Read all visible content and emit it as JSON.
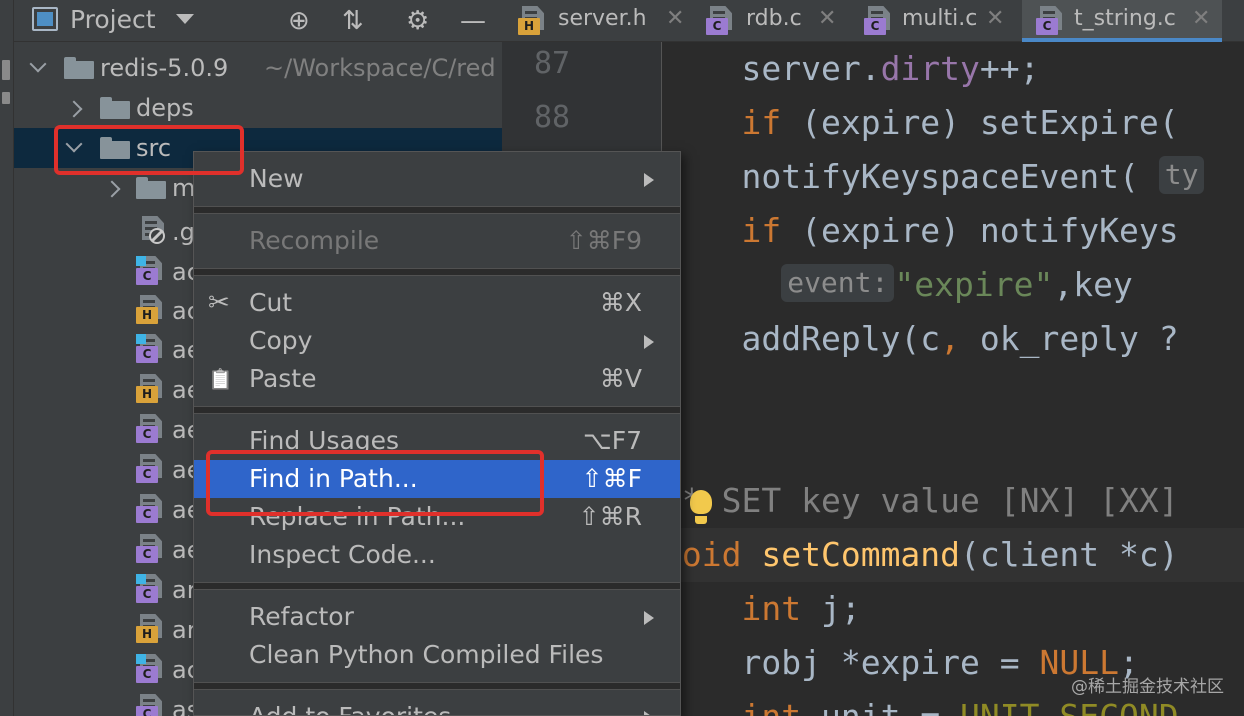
{
  "project_panel": {
    "title": "Project",
    "root": {
      "name": "redis-5.0.9",
      "path": "~/Workspace/C/red"
    },
    "folders": [
      {
        "name": "deps"
      },
      {
        "name": "src"
      },
      {
        "name": "m"
      }
    ],
    "files": [
      {
        "name": ".g",
        "kind": "ignored"
      },
      {
        "name": "ac",
        "kind": "c"
      },
      {
        "name": "ac",
        "kind": "h"
      },
      {
        "name": "ae",
        "kind": "c"
      },
      {
        "name": "ae",
        "kind": "h"
      },
      {
        "name": "ae",
        "kind": "c"
      },
      {
        "name": "ae",
        "kind": "c"
      },
      {
        "name": "ae",
        "kind": "c"
      },
      {
        "name": "ae",
        "kind": "c"
      },
      {
        "name": "ar",
        "kind": "c"
      },
      {
        "name": "ar",
        "kind": "h"
      },
      {
        "name": "ac",
        "kind": "c"
      },
      {
        "name": "as",
        "kind": "c"
      }
    ]
  },
  "tabs": [
    {
      "label": "server.h",
      "kind": "h",
      "close": "✕"
    },
    {
      "label": "rdb.c",
      "kind": "c",
      "close": "✕"
    },
    {
      "label": "multi.c",
      "kind": "c",
      "close": "✕"
    },
    {
      "label": "t_string.c",
      "kind": "c",
      "close": "✕"
    }
  ],
  "editor": {
    "line_numbers": [
      "87",
      "88"
    ],
    "lines": {
      "l1_a": "server.",
      "l1_b": "dirty",
      "l1_c": "++;",
      "l2_kw": "if",
      "l2_a": " (expire) ",
      "l2_fn": "setExpire(",
      "l3_a": "notifyKeyspaceEvent(",
      "l3_hint": "ty",
      "l4_kw": "if",
      "l4_a": " (expire) notifyKeys",
      "l5_hint": "event:",
      "l5_str": "\"expire\"",
      "l5_a": ",key",
      "l6_a": "addReply(c",
      "l6_b": ", ",
      "l6_c": "ok_reply ?",
      "l7_a": "}",
      "l9_cmt": "/* SET key value [NX] [XX]",
      "l10_kw": "void",
      "l10_fn": "setCommand",
      "l10_a": "(client *c)",
      "l11_kw": "int",
      "l11_a": " j;",
      "l12_a": "robj *expire = ",
      "l12_null": "NULL",
      "l12_b": ";",
      "l13_kw": "int",
      "l13_a": " unit = ",
      "l13_macro": "UNIT_SECOND"
    }
  },
  "context_menu": {
    "items": [
      {
        "label": "New",
        "shortcut": "",
        "submenu": true,
        "enabled": true
      },
      {
        "label": "Recompile",
        "shortcut": "⇧⌘F9",
        "submenu": false,
        "enabled": false
      },
      {
        "label": "Cut",
        "shortcut": "⌘X",
        "submenu": false,
        "enabled": true,
        "icon": "✂"
      },
      {
        "label": "Copy",
        "shortcut": "",
        "submenu": true,
        "enabled": true
      },
      {
        "label": "Paste",
        "shortcut": "⌘V",
        "submenu": false,
        "enabled": true,
        "icon": "📋"
      },
      {
        "label": "Find Usages",
        "shortcut": "⌥F7",
        "submenu": false,
        "enabled": true
      },
      {
        "label": "Find in Path...",
        "shortcut": "⇧⌘F",
        "submenu": false,
        "enabled": true,
        "highlighted": true
      },
      {
        "label": "Replace in Path...",
        "shortcut": "⇧⌘R",
        "submenu": false,
        "enabled": true
      },
      {
        "label": "Inspect Code...",
        "shortcut": "",
        "submenu": false,
        "enabled": true
      },
      {
        "label": "Refactor",
        "shortcut": "",
        "submenu": true,
        "enabled": true
      },
      {
        "label": "Clean Python Compiled Files",
        "shortcut": "",
        "submenu": false,
        "enabled": true
      },
      {
        "label": "Add to Favorites",
        "shortcut": "",
        "submenu": true,
        "enabled": true
      }
    ]
  },
  "colors": {
    "highlight": "#2f65ca",
    "annotation": "#e0302b",
    "selected_row": "#0d293e"
  },
  "watermark": "@稀土掘金技术社区"
}
